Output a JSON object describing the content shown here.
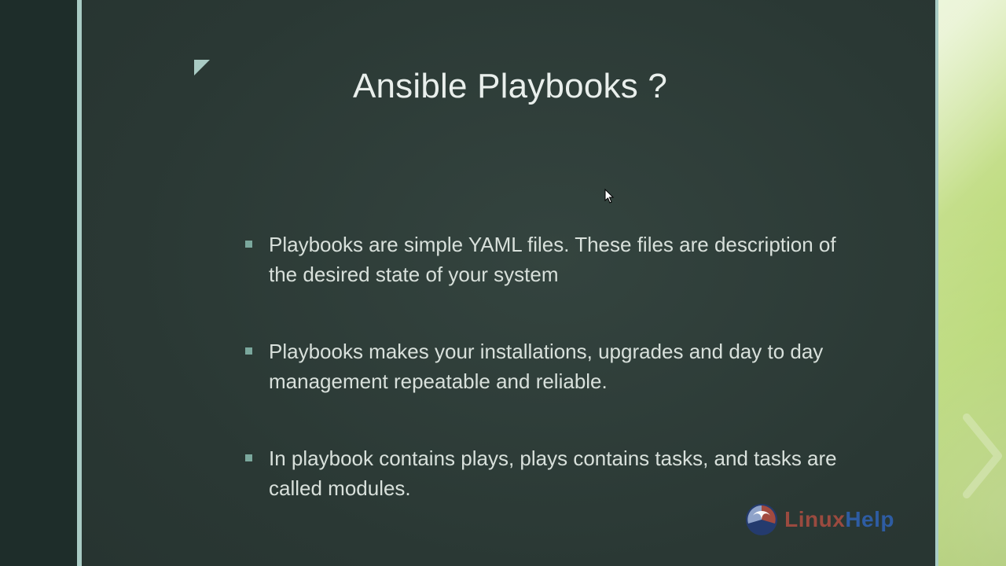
{
  "slide": {
    "title": "Ansible Playbooks ?",
    "bullets": [
      "Playbooks are simple YAML files. These files are description of the desired state of your system",
      "Playbooks makes your  installations, upgrades   and day to day management repeatable and reliable.",
      "In playbook contains plays,  plays contains tasks, and tasks are called modules."
    ]
  },
  "logo": {
    "text_prefix": "Linux",
    "text_suffix": "Help"
  },
  "colors": {
    "slide_bg": "#2a3834",
    "accent": "#a9cbc4",
    "bullet_marker": "#7ba89d",
    "text": "#d8e0db",
    "title": "#e9efec",
    "logo_red": "#9a4a3f",
    "logo_blue": "#2e5ca3",
    "right_panel_green": "#b6d771"
  }
}
